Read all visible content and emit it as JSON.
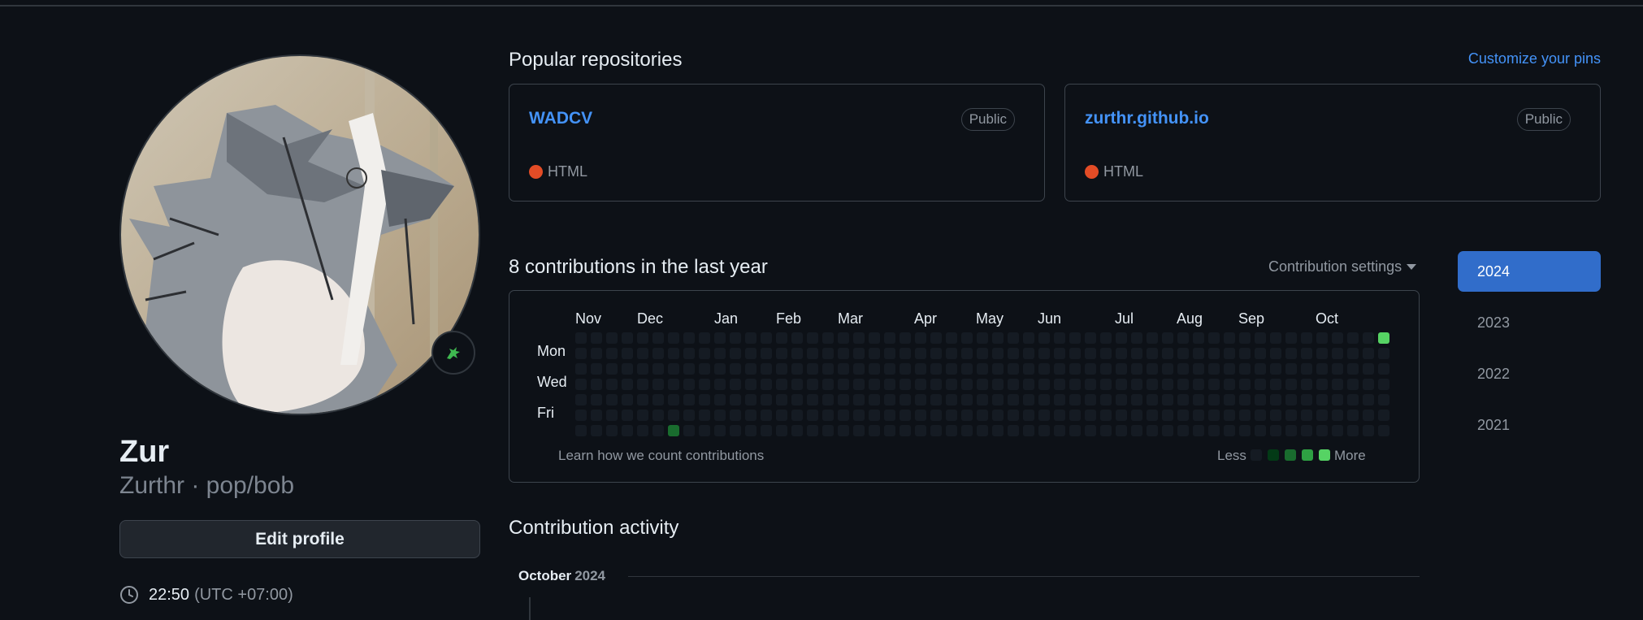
{
  "profile": {
    "name": "Zur",
    "login_line": "Zurthr · pop/bob",
    "edit_button": "Edit profile",
    "time": "22:50",
    "timezone": "(UTC +07:00)",
    "status_icon": "dragon-emoji-icon"
  },
  "popular": {
    "title": "Popular repositories",
    "customize_link": "Customize your pins",
    "repos": [
      {
        "name": "WADCV",
        "visibility": "Public",
        "language": "HTML",
        "language_color": "#e34c26"
      },
      {
        "name": "zurthr.github.io",
        "visibility": "Public",
        "language": "HTML",
        "language_color": "#e34c26"
      }
    ]
  },
  "contributions": {
    "title": "8 contributions in the last year",
    "settings_label": "Contribution settings",
    "months": [
      "Nov",
      "Dec",
      "Jan",
      "Feb",
      "Mar",
      "Apr",
      "May",
      "Jun",
      "Jul",
      "Aug",
      "Sep",
      "Oct"
    ],
    "days": [
      "Mon",
      "Wed",
      "Fri"
    ],
    "learn_link": "Learn how we count contributions",
    "legend_less": "Less",
    "legend_more": "More",
    "colors": {
      "empty": "#151b23",
      "levels": [
        "#151b23",
        "#033a16",
        "#196c2e",
        "#2ea043",
        "#56d364"
      ]
    }
  },
  "years": [
    "2024",
    "2023",
    "2022",
    "2021"
  ],
  "selected_year": "2024",
  "activity": {
    "title": "Contribution activity",
    "month": "October",
    "year": "2024"
  }
}
